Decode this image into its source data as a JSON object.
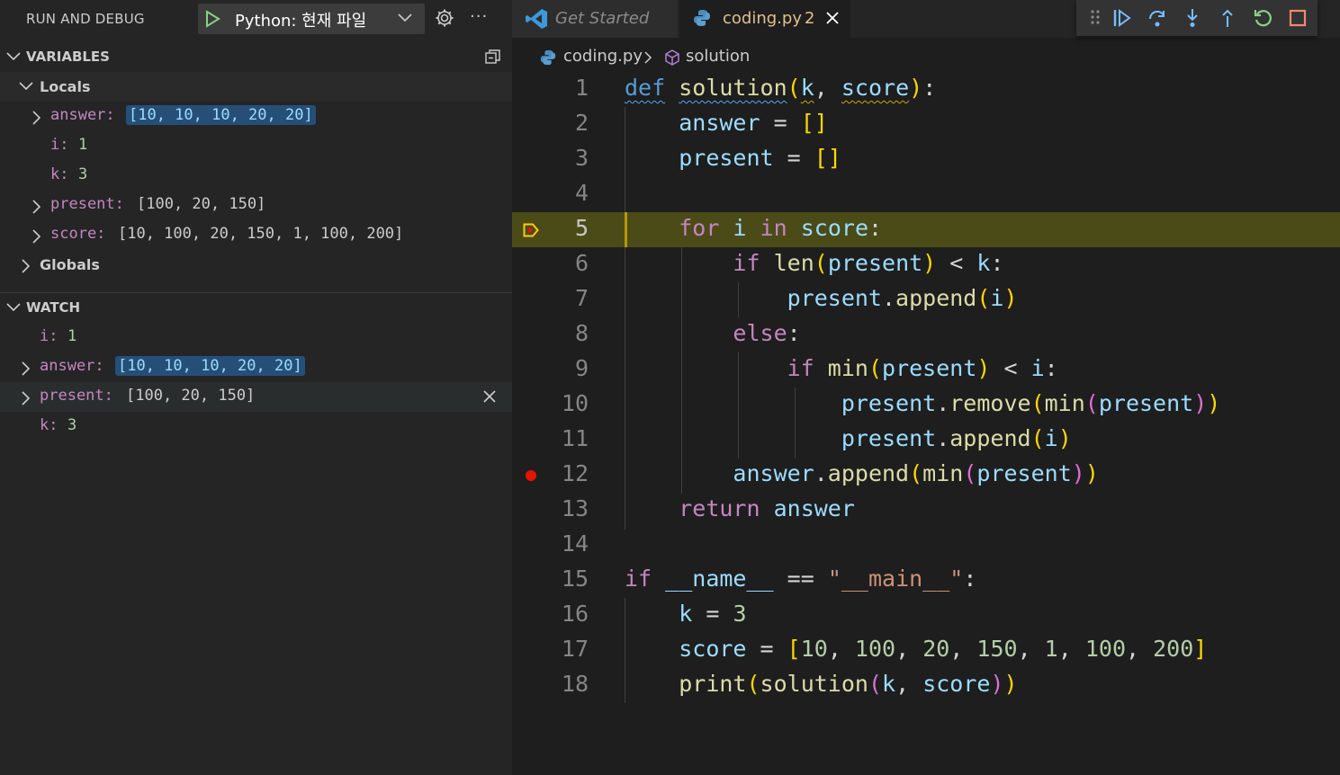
{
  "sidebar": {
    "title": "RUN AND DEBUG",
    "run_config": "Python: 현재 파일",
    "more_label": "···",
    "variables": {
      "title": "VARIABLES",
      "locals_label": "Locals",
      "globals_label": "Globals",
      "locals": [
        {
          "name": "answer:",
          "value": "[10, 10, 10, 20, 20]",
          "expandable": true
        },
        {
          "name": "i:",
          "value": "1",
          "expandable": false
        },
        {
          "name": "k:",
          "value": "3",
          "expandable": false
        },
        {
          "name": "present:",
          "value": "[100, 20, 150]",
          "expandable": true
        },
        {
          "name": "score:",
          "value": "[10, 100, 20, 150, 1, 100, 200]",
          "expandable": true
        }
      ]
    },
    "watch": {
      "title": "WATCH",
      "items": [
        {
          "name": "i:",
          "value": "1"
        },
        {
          "name": "answer:",
          "value": "[10, 10, 10, 20, 20]"
        },
        {
          "name": "present:",
          "value": "[100, 20, 150]"
        },
        {
          "name": "k:",
          "value": "3"
        }
      ]
    }
  },
  "editor": {
    "tabs": [
      {
        "label": "Get Started",
        "active": false
      },
      {
        "label": "coding.py",
        "problems": "2",
        "active": true
      }
    ],
    "breadcrumb": {
      "file": "coding.py",
      "symbol": "solution"
    },
    "current_line": 5,
    "breakpoint_line": 12,
    "line_numbers": [
      "1",
      "2",
      "3",
      "4",
      "5",
      "6",
      "7",
      "8",
      "9",
      "10",
      "11",
      "12",
      "13",
      "14",
      "15",
      "16",
      "17",
      "18"
    ]
  },
  "colors": {
    "accent_play": "#89d185",
    "debug_blue": "#75beff",
    "breakpoint": "#e51400",
    "current_line_bg": "#4b4b18"
  },
  "icons": {
    "play": "play-icon",
    "gear": "gear-icon",
    "python_file": "python-file-icon",
    "vscode": "vscode-icon"
  }
}
